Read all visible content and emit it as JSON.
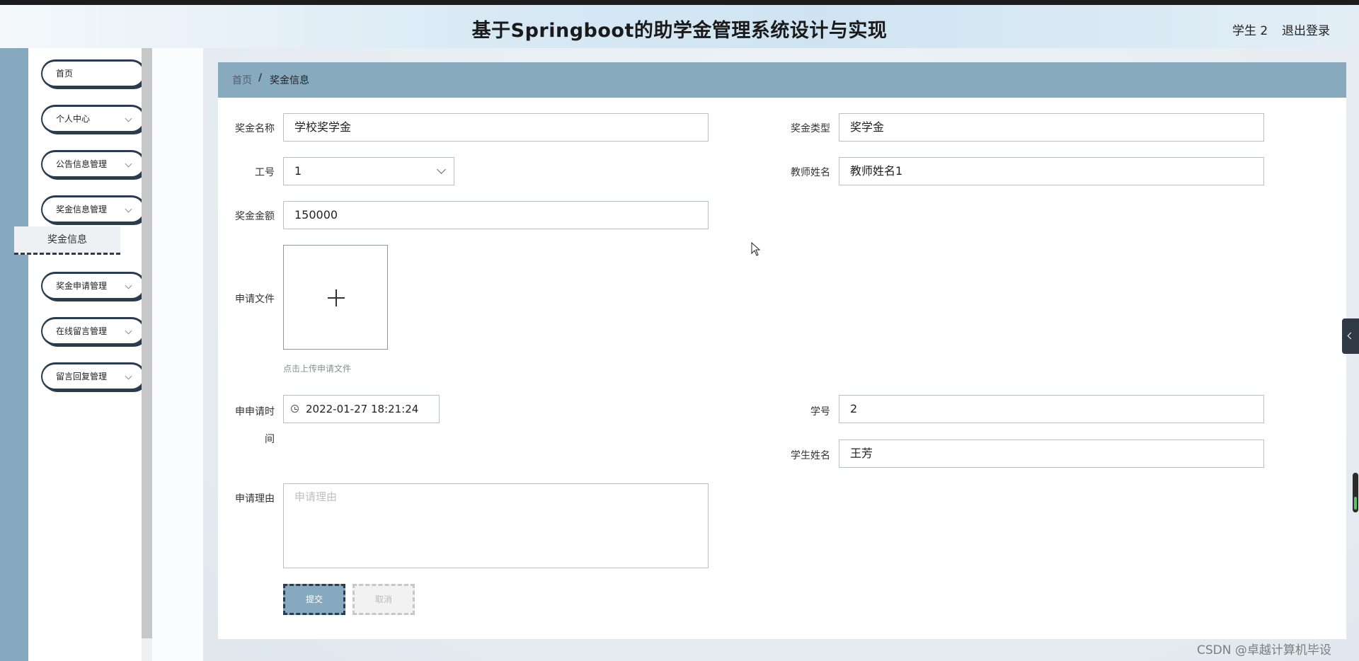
{
  "header": {
    "title": "基于Springboot的助学金管理系统设计与实现",
    "user_label": "学生 2",
    "logout_label": "退出登录"
  },
  "sidebar": {
    "items": [
      {
        "label": "首页",
        "has_submenu": false
      },
      {
        "label": "个人中心",
        "has_submenu": true
      },
      {
        "label": "公告信息管理",
        "has_submenu": true
      },
      {
        "label": "奖金信息管理",
        "has_submenu": true,
        "expanded": true
      },
      {
        "label": "奖金申请管理",
        "has_submenu": true
      },
      {
        "label": "在线留言管理",
        "has_submenu": true
      },
      {
        "label": "留言回复管理",
        "has_submenu": true
      }
    ],
    "active_submenu_label": "奖金信息"
  },
  "breadcrumb": {
    "home": "首页",
    "separator": "/",
    "current": "奖金信息"
  },
  "form": {
    "award_name_label": "奖金名称",
    "award_name_value": "学校奖学金",
    "award_type_label": "奖金类型",
    "award_type_value": "奖学金",
    "staff_id_label": "工号",
    "staff_id_value": "1",
    "teacher_name_label": "教师姓名",
    "teacher_name_value": "教师姓名1",
    "amount_label": "奖金金额",
    "amount_value": "150000",
    "file_label": "申请文件",
    "upload_hint": "点击上传申请文件",
    "apply_time_label_line1": "申申请时",
    "apply_time_label_line2": "间",
    "apply_time_value": "2022-01-27 18:21:24",
    "student_id_label": "学号",
    "student_id_value": "2",
    "student_name_label": "学生姓名",
    "student_name_value": "王芳",
    "reason_label": "申请理由",
    "reason_placeholder": "申请理由",
    "submit_label": "提交",
    "cancel_label": "取消"
  },
  "watermark": "CSDN @卓越计算机毕设",
  "colors": {
    "sidebar_rail": "#86a9bf",
    "breadcrumb_bar": "#88aabf",
    "menu_border": "#2a3d4f",
    "submit_button": "#86a9bf"
  }
}
